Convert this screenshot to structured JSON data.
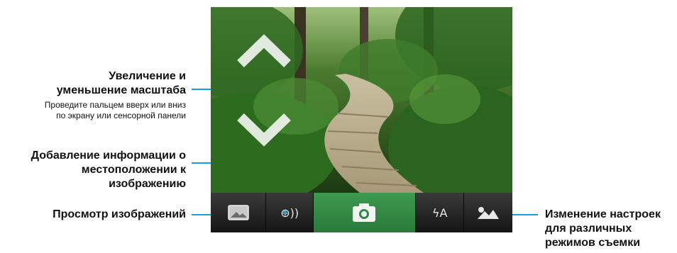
{
  "callouts": {
    "zoom": {
      "title_line1": "Увеличение и",
      "title_line2": "уменьшение масштаба",
      "desc_line1": "Проведите пальцем вверх или вниз",
      "desc_line2": "по экрану или сенсорной панели"
    },
    "location": {
      "line1": "Добавление информации о",
      "line2": "местоположении к",
      "line3": "изображению"
    },
    "view": {
      "label": "Просмотр изображений"
    },
    "scene": {
      "line1": "Изменение настроек",
      "line2": "для различных",
      "line3": "режимов съемки"
    }
  },
  "toolbar": {
    "items": [
      {
        "icon": "gallery-icon"
      },
      {
        "icon": "geotag-icon",
        "glyph": "⊕))"
      },
      {
        "icon": "camera-icon"
      },
      {
        "icon": "flash-auto-icon",
        "glyph": "ϟA"
      },
      {
        "icon": "scene-mode-icon"
      }
    ]
  },
  "colors": {
    "leader": "#1aa0d8",
    "camera_button": "#2f8a41",
    "toolbar": "#222222"
  }
}
